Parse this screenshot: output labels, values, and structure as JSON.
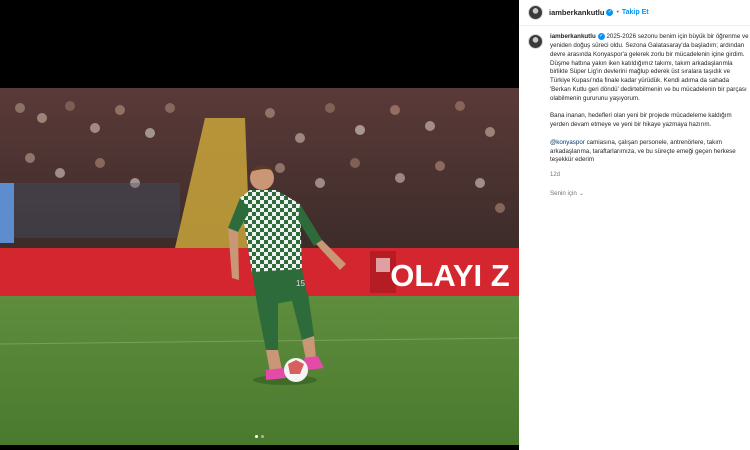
{
  "post": {
    "username": "iamberkankutlu",
    "follow_label": "Takip Et",
    "separator": "•",
    "verified_glyph": "✓",
    "caption": {
      "p1_rest": " 2025-2026 sezonu benim için büyük bir öğrenme ve yeniden doğuş süreci oldu. Sezona Galatasaray'da başladım; ardından devre arasında Konyaspor'a gelerek zorlu bir mücadelenin içine girdim. Düşme hattına yakın iken katıldığımız takımı, takım arkadaşlarımla birlikte Süper Lig'in devlerini mağlup ederek üst sıralara taşıdık ve Türkiye Kupası'nda finale kadar yürüdük. Kendi adıma da sahada 'Berkan Kutlu geri döndü' dedirtebilmenin ve bu mücadelenin bir parçası olabilmenin gururunu yaşıyorum.",
      "p2": "Bana inanan, hedefleri olan yeni bir projede mücadeleme kaldığım yerden devam etmeye ve yeni bir hikaye yazmaya hazırım.",
      "p3_mention": "@konyaspor",
      "p3_rest": " camiasına, çalışan personele, antrenörlere, takım arkadaşlarıma, taraftarlarımıza, ve bu süreçte emeği geçen herkese teşekkür ederim"
    },
    "time_ago": "12d",
    "translation_label": "Senin için",
    "translation_icon": "chevron-down-icon"
  },
  "photo": {
    "banner_text": "OLAYI Z",
    "jersey_number": "15"
  },
  "carousel": {
    "slide_count": 2,
    "active_index": 0
  }
}
